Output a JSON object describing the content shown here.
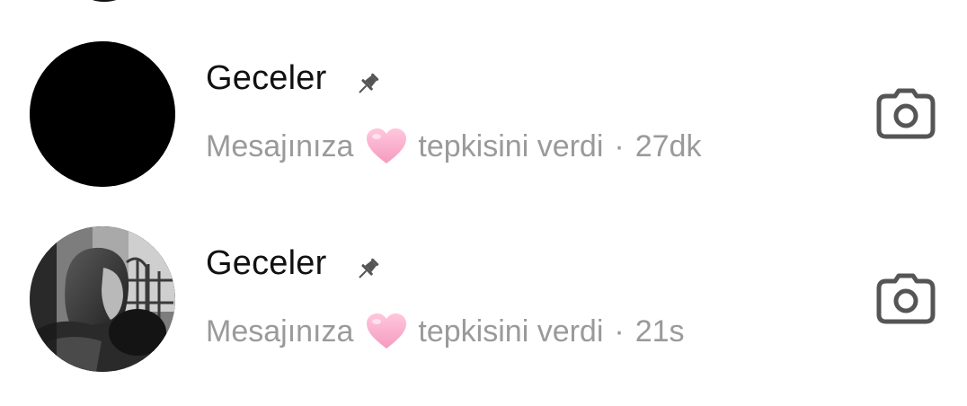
{
  "threads": [
    {
      "name": "Geceler",
      "preview_prefix": "Mesajınıza",
      "preview_suffix": "tepkisini verdi",
      "separator": "·",
      "time": "27dk",
      "pinned": true,
      "avatar": "black-circle",
      "reaction_icon": "pink-heart",
      "action_icon": "camera-icon"
    },
    {
      "name": "Geceler",
      "preview_prefix": "Mesajınıza",
      "preview_suffix": "tepkisini verdi",
      "separator": "·",
      "time": "21s",
      "pinned": true,
      "avatar": "grayscale-photo",
      "reaction_icon": "pink-heart",
      "action_icon": "camera-icon"
    }
  ],
  "colors": {
    "name_text": "#111111",
    "secondary_text": "#9a9a9a",
    "icon_gray": "#555555",
    "heart_pink": "#f9a8c8"
  }
}
